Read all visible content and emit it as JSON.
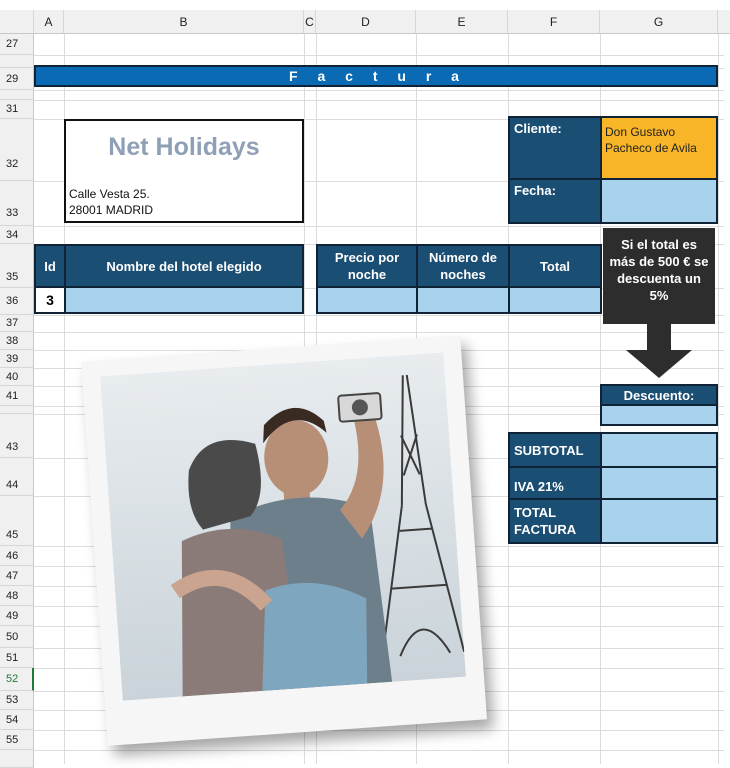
{
  "columns": [
    "A",
    "B",
    "C",
    "D",
    "E",
    "F",
    "G"
  ],
  "rows": [
    "27",
    "29",
    "31",
    "32",
    "33",
    "34",
    "35",
    "36",
    "37",
    "38",
    "39",
    "40",
    "41",
    "43",
    "44",
    "45",
    "46",
    "47",
    "48",
    "49",
    "50",
    "51",
    "52",
    "53",
    "54",
    "55"
  ],
  "selected_row": "52",
  "banner": {
    "title": "F a c t u r a"
  },
  "company": {
    "name": "Net Holidays",
    "address_line1": "Calle Vesta 25.",
    "address_line2": "28001 MADRID"
  },
  "client": {
    "label": "Cliente:",
    "value": "Don Gustavo Pacheco de Avila"
  },
  "date": {
    "label": "Fecha:",
    "value": ""
  },
  "table": {
    "headers": {
      "id": "Id",
      "hotel": "Nombre del hotel elegido",
      "price": "Precio por noche",
      "nights": "Número de noches",
      "total": "Total"
    },
    "row": {
      "id": "3",
      "hotel": "",
      "price": "",
      "nights": "",
      "total": ""
    }
  },
  "note": {
    "text": "Si el total es más de 500 € se descuenta un 5%"
  },
  "discount": {
    "label": "Descuento:",
    "value": ""
  },
  "summary": {
    "subtotal_label": "SUBTOTAL",
    "iva_label": "IVA 21%",
    "total_label": "TOTAL FACTURA"
  },
  "colors": {
    "dark_blue": "#1b4e73",
    "light_blue": "#a9d3ec",
    "banner_blue": "#0b6ab4",
    "client_orange": "#f7b527",
    "note_dark": "#2d2d2d"
  },
  "icons": [
    "down-arrow-icon",
    "couple-photo"
  ]
}
